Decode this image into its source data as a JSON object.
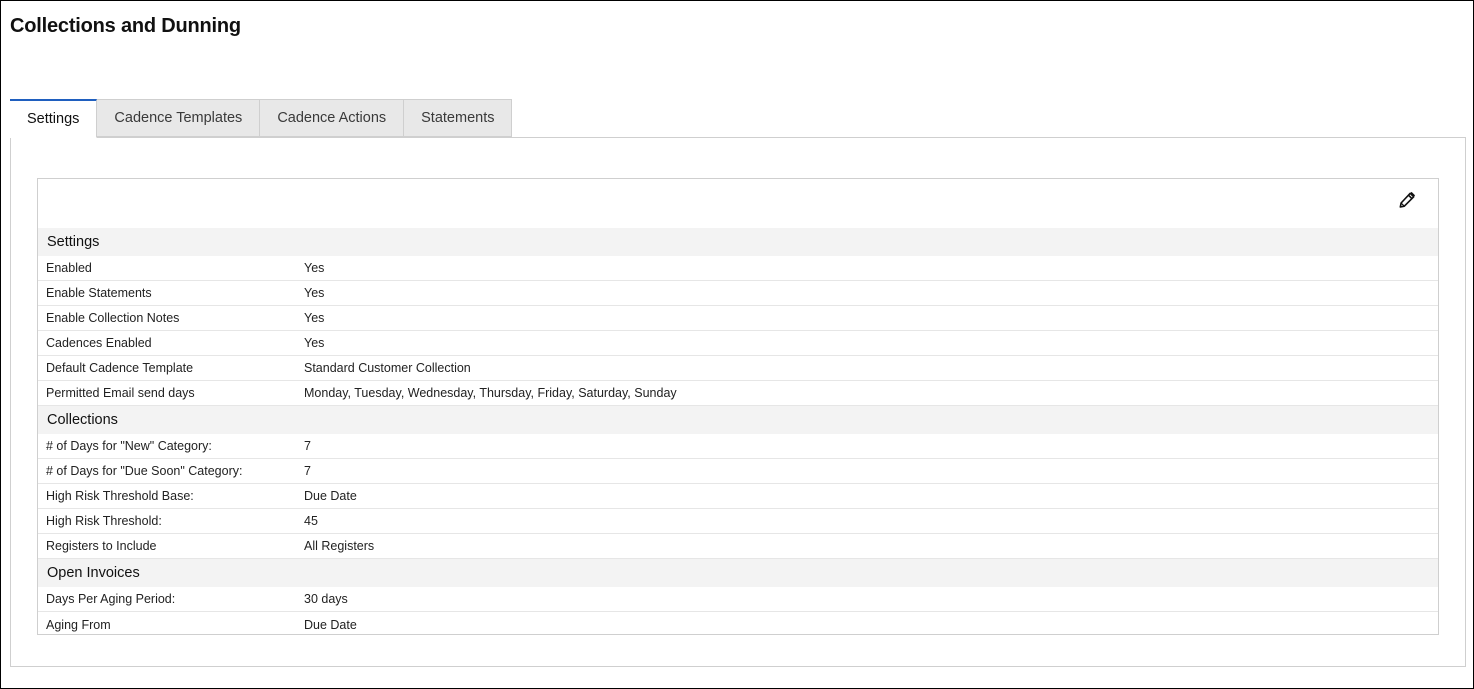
{
  "page": {
    "title": "Collections and Dunning"
  },
  "tabs": [
    {
      "label": "Settings",
      "active": true
    },
    {
      "label": "Cadence Templates",
      "active": false
    },
    {
      "label": "Cadence Actions",
      "active": false
    },
    {
      "label": "Statements",
      "active": false
    }
  ],
  "card": {
    "edit_icon": "pencil-icon"
  },
  "sections": {
    "settings": {
      "header": "Settings",
      "rows": [
        {
          "label": "Enabled",
          "value": "Yes"
        },
        {
          "label": "Enable Statements",
          "value": "Yes"
        },
        {
          "label": "Enable Collection Notes",
          "value": "Yes"
        },
        {
          "label": "Cadences Enabled",
          "value": "Yes"
        },
        {
          "label": "Default Cadence Template",
          "value": "Standard Customer Collection"
        },
        {
          "label": "Permitted Email send days",
          "value": "Monday, Tuesday, Wednesday, Thursday, Friday, Saturday, Sunday"
        }
      ]
    },
    "collections": {
      "header": "Collections",
      "rows": [
        {
          "label": "# of Days for \"New\" Category:",
          "value": "7"
        },
        {
          "label": "# of Days for \"Due Soon\" Category:",
          "value": "7"
        },
        {
          "label": "High Risk Threshold Base:",
          "value": "Due Date"
        },
        {
          "label": "High Risk Threshold:",
          "value": "45"
        },
        {
          "label": "Registers to Include",
          "value": "All Registers"
        }
      ]
    },
    "open_invoices": {
      "header": "Open Invoices",
      "rows": [
        {
          "label": "Days Per Aging Period:",
          "value": "30 days"
        },
        {
          "label": "Aging From",
          "value": "Due Date"
        }
      ]
    }
  },
  "colors": {
    "accent": "#1f5fbf",
    "section_bg": "#f3f3f3",
    "tab_bg": "#e8e8e8",
    "border": "#cfcfcf"
  }
}
